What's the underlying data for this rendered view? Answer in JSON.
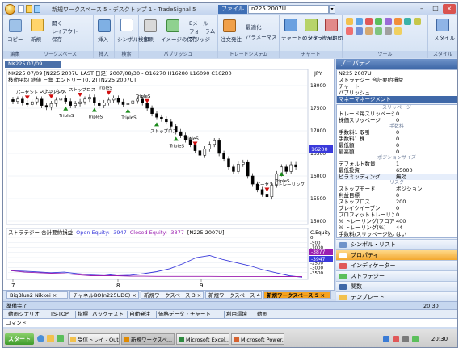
{
  "titlebar": {
    "title": "新規ワークスペース 5 - デスクトップ 1 - TradeSignal 5",
    "file_menu": "ファイル",
    "symbol": "n225 2007U",
    "minimize": "–",
    "maximize": "□",
    "close": "×"
  },
  "ribbon": {
    "groups": [
      {
        "label": "編集",
        "items": [
          "コピー"
        ]
      },
      {
        "label": "ワークスペース",
        "items": [
          "新規",
          "開く",
          "レイアウト",
          "保存"
        ]
      },
      {
        "label": "挿入",
        "items": [
          "挿入"
        ]
      },
      {
        "label": "検索",
        "items": [
          "シンボル検索"
        ]
      },
      {
        "label": "パブリッシュ",
        "items": [
          "印刷",
          "イメージの保存",
          "Eメール",
          "フォーラム",
          "ブリッジ"
        ]
      },
      {
        "label": "トレードシステム",
        "items": [
          "注文発注",
          "最適化",
          "パラメーマス"
        ]
      },
      {
        "label": "チャート",
        "items": [
          "チャートのタイプ",
          "インター バル",
          "表示期間"
        ]
      },
      {
        "label": "ツール",
        "items": []
      },
      {
        "label": "スタイル",
        "items": [
          "スタイル"
        ]
      }
    ]
  },
  "chart": {
    "tab_label": "NK225 07/09",
    "header": "NK225 07/09 [N225 2007U LAST 日足] 2007/08/30 - O16270 H16280 L16090 C16200",
    "indicator": "移動平均 終値 三角 エントリー [0, 2] [N225 2007U]",
    "price_axis_unit": "JPY",
    "date_labels": [
      "7",
      "8",
      "9"
    ],
    "lower_title": "ストラテジー 合計要約損益",
    "lower_open_equity": "Open Equity: -3947",
    "lower_closed_equity": "Closed Equity: -3877",
    "lower_symbol": "[N225 2007U]",
    "lower_axis_unit": "C.Equity",
    "signal_labels": [
      "パーセントトレーリング",
      "ストップロス",
      "TripleS",
      "ストップロス",
      "TripleS",
      "TripleS",
      "TripleS",
      "TripleS",
      "ストップロス",
      "TripleS",
      "TripleS",
      "パーセントトレーリング",
      "TripleS"
    ],
    "colors": {
      "candle_up": "#ffffff",
      "candle_down": "#000000",
      "buy_arrow": "#1a8a1a",
      "sell_arrow": "#d01010",
      "equity_open": "#3a3adb",
      "equity_closed": "#9b1fb0",
      "price_marker": "#3a3adb"
    }
  },
  "chart_data": {
    "type": "line",
    "title": "NK225 07/09 [N225 2007U LAST 日足]",
    "price_range": [
      15000,
      18000
    ],
    "price_ticks": [
      "18000",
      "17500",
      "17000",
      "16500",
      "16000",
      "15500",
      "15000"
    ],
    "equity_ticks": [
      "0",
      "-500",
      "-1000",
      "-1500",
      "-2000",
      "-2500",
      "-3000",
      "-3500"
    ],
    "last_price_marker": "16200",
    "equity_markers": [
      "-3877",
      "-3947"
    ],
    "series": [
      {
        "name": "Open Equity",
        "values": [
          -3300,
          -3350,
          -3420,
          -3500,
          -3450,
          -3600,
          -3700,
          -3650,
          -3800,
          -3750,
          -3600,
          -3400,
          -3100,
          -2600,
          -2000,
          -1800,
          -2200,
          -2500,
          -2800,
          -3200,
          -3500,
          -3800,
          -3947
        ]
      },
      {
        "name": "Closed Equity",
        "values": [
          -3300,
          -3450,
          -3500,
          -3560,
          -3600,
          -3700,
          -3800,
          -3800,
          -3800,
          -3850,
          -3850,
          -3860,
          -3860,
          -3860,
          -3860,
          -3860,
          -3870,
          -3870,
          -3870,
          -3870,
          -3877,
          -3877,
          -3877
        ]
      }
    ]
  },
  "panel": {
    "title": "プロパティ",
    "tree": [
      "N225 2007U",
      "ストラテジー 合計要約損益",
      "チャート",
      "パブリッシュ",
      "マネーマネージメント"
    ],
    "sections": [
      {
        "header": "スリッページ",
        "rows": [
          [
            "トレード毎スリッページ",
            "0"
          ],
          [
            "株価スリッページ",
            "0"
          ]
        ]
      },
      {
        "header": "手数料",
        "rows": [
          [
            "手数料1 取引",
            "0"
          ],
          [
            "手数料1 株",
            "0"
          ],
          [
            "最低額",
            "0"
          ],
          [
            "最高額",
            "0"
          ]
        ]
      },
      {
        "header": "ポジションサイズ",
        "rows": [
          [
            "デフォルト数量",
            "1"
          ],
          [
            "最低投資",
            "65000"
          ],
          [
            "ピラミッディング",
            "無効"
          ]
        ]
      },
      {
        "header": "リスク",
        "rows": [
          [
            "ストップモード",
            "ポジション"
          ],
          [
            "利益目標",
            "0"
          ],
          [
            "ストップロス",
            "200"
          ],
          [
            "ブレイクイーブン",
            "0"
          ],
          [
            "プロフィットトレーリング",
            "0"
          ],
          [
            "% トレーリング(フロア)",
            "400"
          ],
          [
            "% トレーリング(%)",
            "44"
          ],
          [
            "手数料/スリッページ込み",
            "はい"
          ]
        ]
      }
    ],
    "nav": [
      "シンボル・リスト",
      "プロパティ",
      "インディケーター",
      "ストラテジー",
      "関数",
      "テンプレート"
    ],
    "active_nav": "プロパティ"
  },
  "workspace_tabs": [
    "BigBlue2 Nikkei ×",
    "チャネルBO(n225UDC) ×",
    "新規ワークスペース 3 ×",
    "新規ワークスペース 4",
    "新規ワークスペース 5 ×"
  ],
  "statusbar": {
    "text": "準備完了",
    "time": "20:30"
  },
  "sheet_tabs": [
    "動画シナリオ",
    "TS-TOP",
    "指標",
    "バックテスト",
    "自動発注",
    "価格データ・チャート",
    "利用環境",
    "動画"
  ],
  "commandbar": {
    "label": "コマンド"
  },
  "taskbar": {
    "start": "スタート",
    "buttons": [
      "受信トレイ - Out...",
      "新規ワークスペ...",
      "Microsoft Excel...",
      "Microsoft Power..."
    ],
    "active": "新規ワークスペ...",
    "clock": "20:30"
  }
}
